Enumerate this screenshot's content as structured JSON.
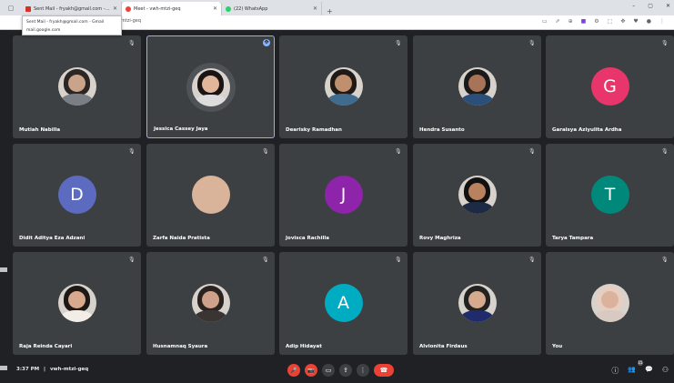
{
  "browser": {
    "tabs": [
      {
        "title": "Sent Mail - fryakh@gmail.com - Gmail",
        "color": "#d93025"
      },
      {
        "title": "Meet - vwh-mtzi-geq",
        "color": "#ea4335"
      },
      {
        "title": "(22) WhatsApp",
        "color": "#25d366"
      }
    ],
    "newtab": "+",
    "minimize": "–",
    "restore": "▢",
    "close": "✕",
    "popup_line1": "Sent Mail - fryakh@gmail.com - Gmail",
    "popup_line2": "mail.google.com",
    "address": "th-mtzi-geq"
  },
  "participants": [
    {
      "name": "Mutiah Nabilla",
      "type": "photo",
      "skin": "#c9a48a",
      "hair": "#2b2523",
      "shirt": "#7a7f86"
    },
    {
      "name": "Jessica Cassey Jaya",
      "type": "photo",
      "skin": "#e1b79c",
      "hair": "#1a1514",
      "shirt": "#dcdcdc",
      "pinned": true
    },
    {
      "name": "Dearisky Ramadhan",
      "type": "photo",
      "skin": "#bf8f6e",
      "hair": "#1f1a18",
      "shirt": "#3f6b8f"
    },
    {
      "name": "Hendra Susanto",
      "type": "photo",
      "skin": "#a87458",
      "hair": "#1a1a1a",
      "shirt": "#2a4f7a"
    },
    {
      "name": "Garaisya Aziyulita Ardha",
      "type": "letter",
      "letter": "G",
      "color": "#e8366d"
    },
    {
      "name": "Didit Aditya Eza Adzani",
      "type": "letter",
      "letter": "D",
      "color": "#5c6bc0"
    },
    {
      "name": "Zarfa Naida Pratista",
      "type": "blank",
      "color": "#d9b49b"
    },
    {
      "name": "Jovisca Rachilla",
      "type": "letter",
      "letter": "J",
      "color": "#8e24aa"
    },
    {
      "name": "Rovy Maghriza",
      "type": "photo",
      "skin": "#b9825e",
      "hair": "#111",
      "shirt": "#1d2a44"
    },
    {
      "name": "Tarya Tampara",
      "type": "letter",
      "letter": "T",
      "color": "#00897b"
    },
    {
      "name": "Raja Reinda Cayari",
      "type": "photo",
      "skin": "#d8a98c",
      "hair": "#1d1715",
      "shirt": "#f2ede7"
    },
    {
      "name": "Husnamnaq Syaura",
      "type": "photo",
      "skin": "#cfa18a",
      "hair": "#2a2320",
      "shirt": "#3a3533"
    },
    {
      "name": "Adip Hidayat",
      "type": "letter",
      "letter": "A",
      "color": "#00acc1"
    },
    {
      "name": "Alvionita Firdaus",
      "type": "photo",
      "skin": "#d5aa8e",
      "hair": "#222",
      "shirt": "#1f2b6b"
    },
    {
      "name": "You",
      "type": "photo",
      "skin": "#dbb39c",
      "hair": "#e6cfc2",
      "shirt": "#d8c9c2"
    }
  ],
  "meeting": {
    "time": "3:37 PM",
    "separator": "|",
    "code": "vwh-mtzi-geq"
  },
  "controls": {
    "mic": "🎤",
    "cam": "📷",
    "captions": "▭",
    "present": "⇪",
    "more": "⋮",
    "end": "☎",
    "info": "ⓘ",
    "people": "👥",
    "people_count": "15",
    "chat": "💬",
    "activities": "⚇"
  }
}
